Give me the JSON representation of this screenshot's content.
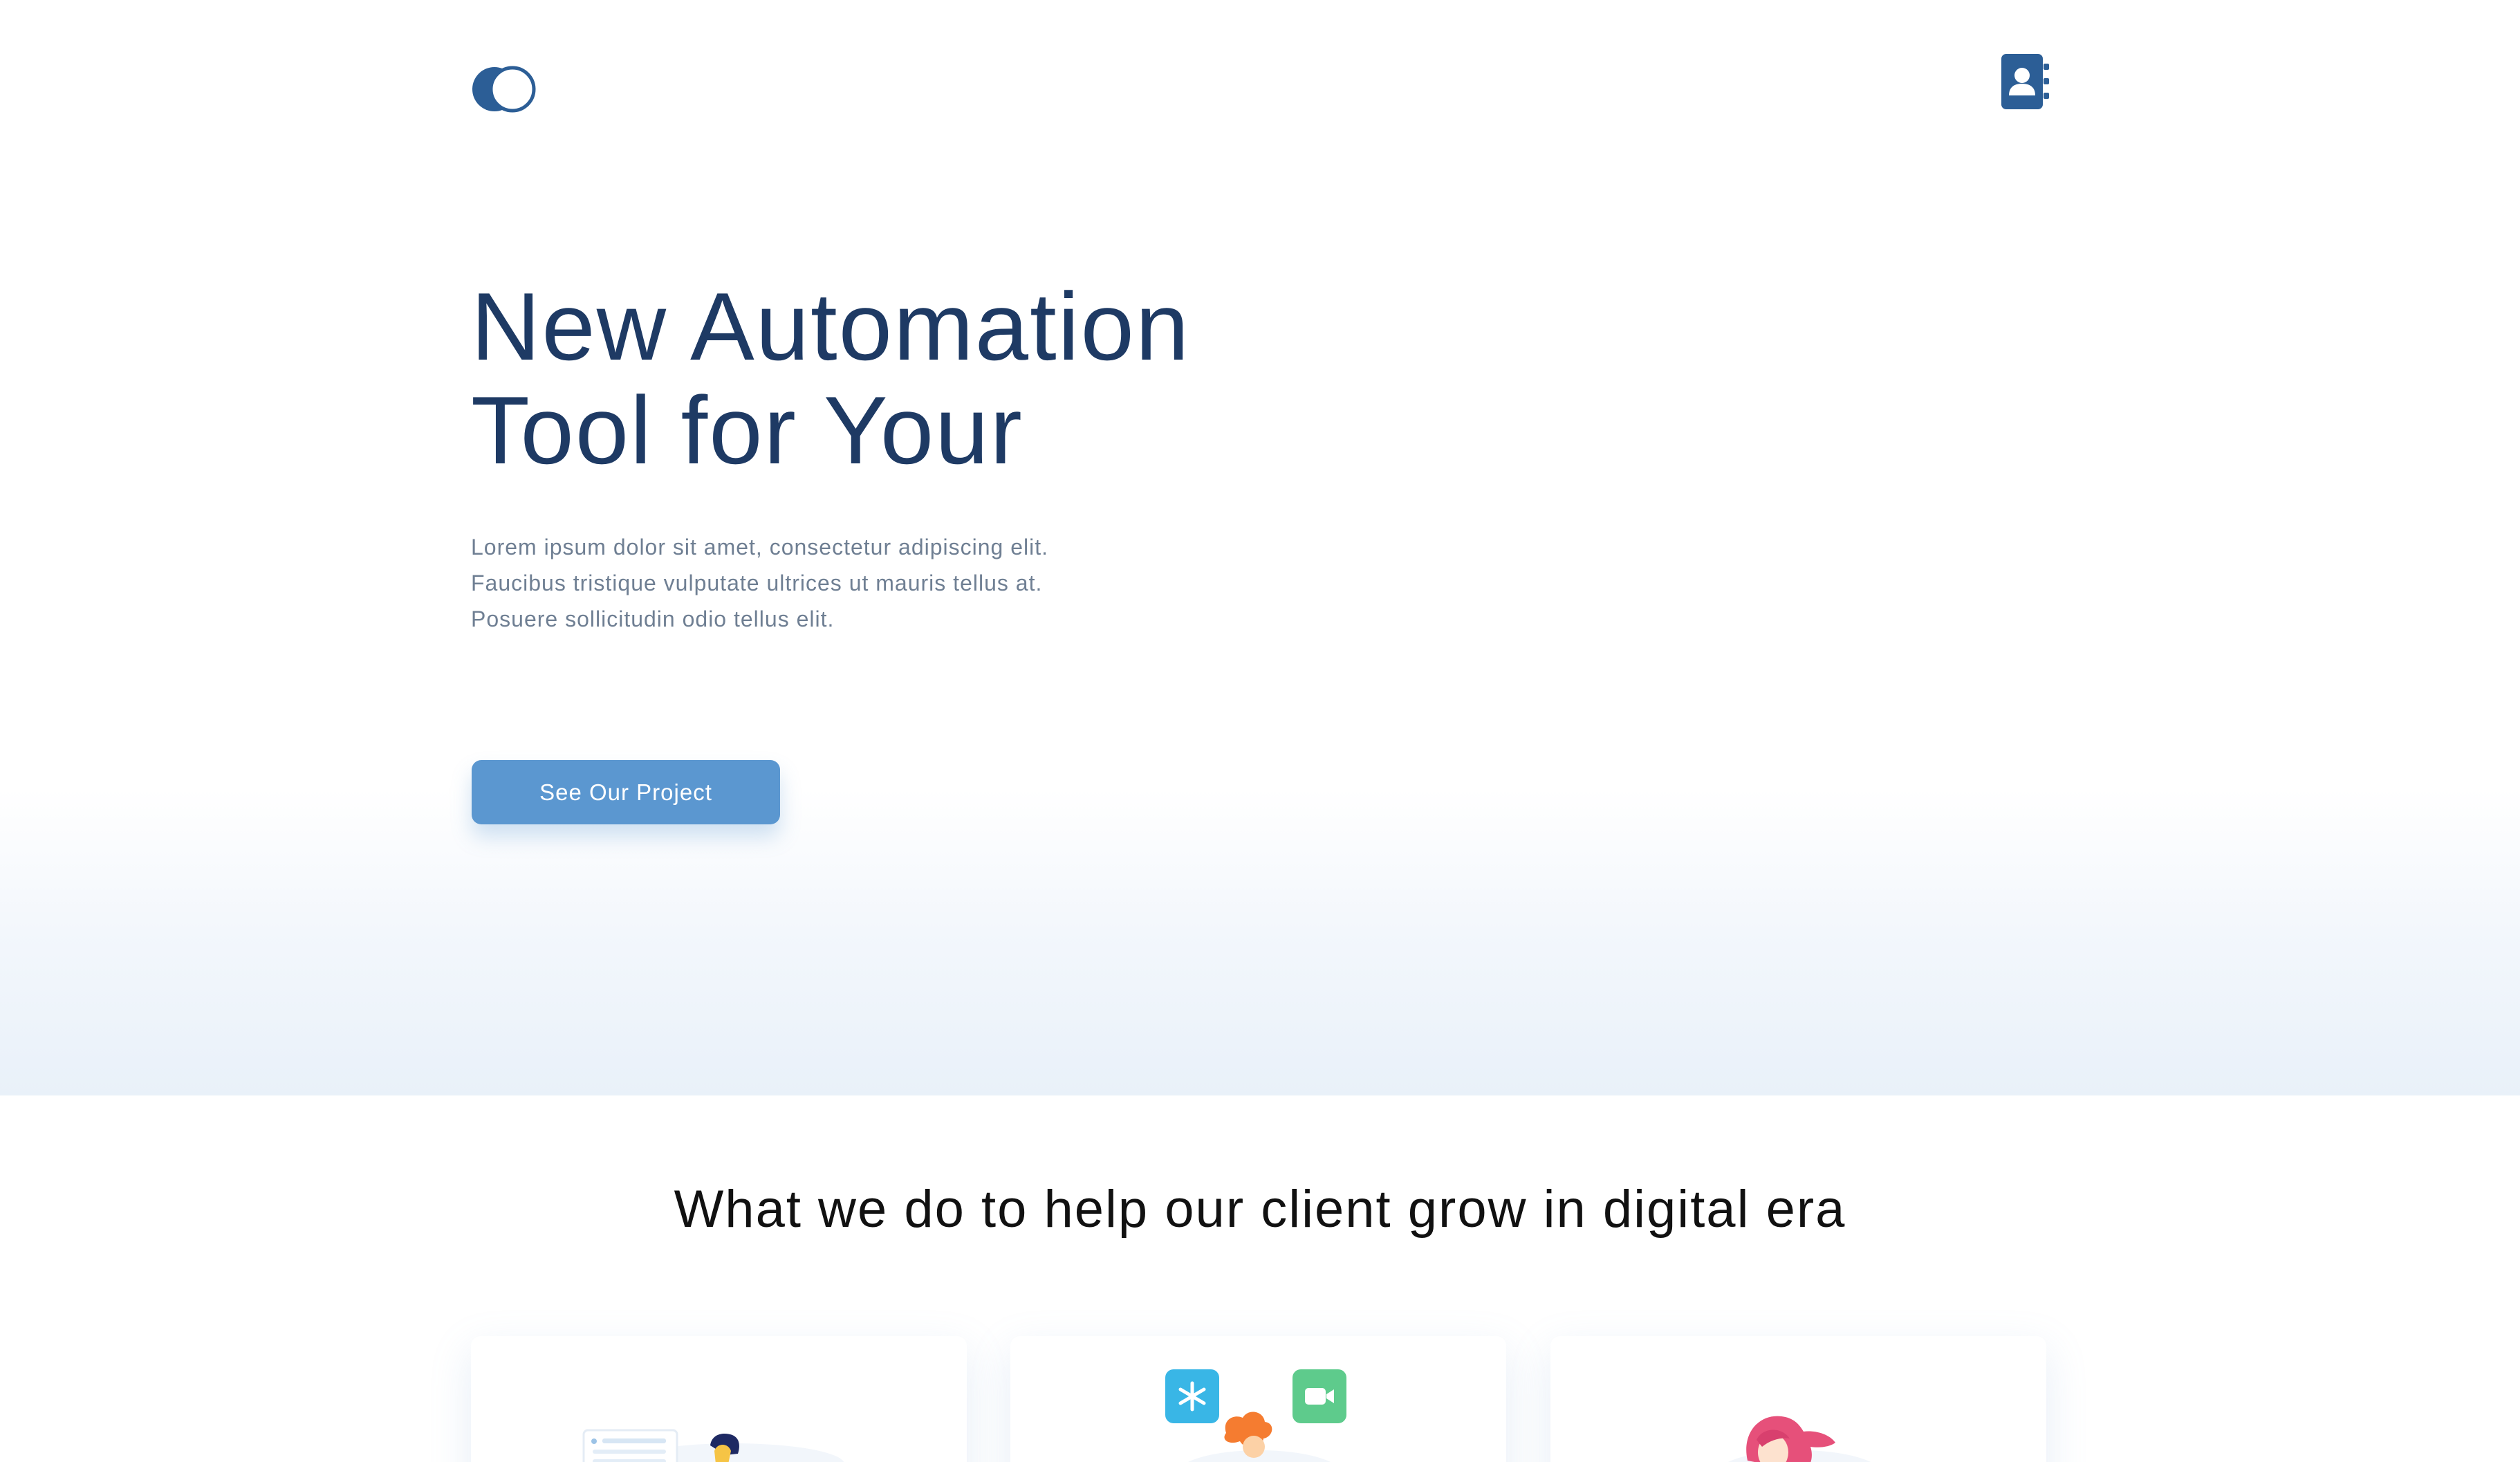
{
  "header": {
    "logo_icon": "toggle-circles-logo",
    "contact_icon": "address-book-icon"
  },
  "hero": {
    "title_line1": "New Automation",
    "title_line2": "Tool for Your",
    "description": "Lorem ipsum dolor sit amet, consectetur adipiscing elit. Faucibus tristique vulputate ultrices ut mauris tellus at. Posuere sollicitudin odio tellus elit.",
    "cta_label": "See Our Project"
  },
  "services": {
    "title": "What we do to help our client grow in digital era",
    "cards": [
      {
        "illustration": "document-person-illustration"
      },
      {
        "illustration": "chat-apps-illustration"
      },
      {
        "illustration": "woman-pink-hair-illustration"
      }
    ]
  },
  "colors": {
    "primary_dark": "#1e3a64",
    "logo_blue": "#2c5e96",
    "button_blue": "#5b97d0",
    "text_muted": "#6f7f93"
  }
}
